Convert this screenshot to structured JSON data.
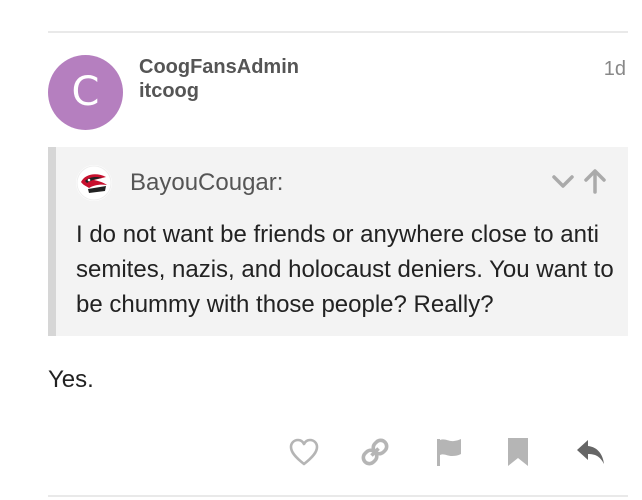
{
  "post": {
    "author": {
      "avatar_letter": "C",
      "avatar_color": "#b57fbf",
      "username": "CoogFansAdmin",
      "title": "itcoog"
    },
    "date": "1d",
    "quote": {
      "author": "BayouCougar:",
      "avatar_icon": "cougar-logo-icon",
      "text": "I do not want be friends or anywhere close to anti semites, nazis, and holocaust deniers. You want to be chummy with those people? Really?",
      "controls": [
        "chevron-down-icon",
        "arrow-up-icon"
      ]
    },
    "body": "Yes.",
    "actions": [
      {
        "name": "like",
        "icon": "heart-icon"
      },
      {
        "name": "share",
        "icon": "link-icon"
      },
      {
        "name": "flag",
        "icon": "flag-icon"
      },
      {
        "name": "bookmark",
        "icon": "bookmark-icon"
      },
      {
        "name": "reply",
        "icon": "reply-icon"
      }
    ]
  },
  "colors": {
    "icon_gray": "#b5b5b5",
    "reply_icon": "#666666",
    "quote_bg": "#f3f3f3",
    "quote_border": "#d6d6d6"
  }
}
